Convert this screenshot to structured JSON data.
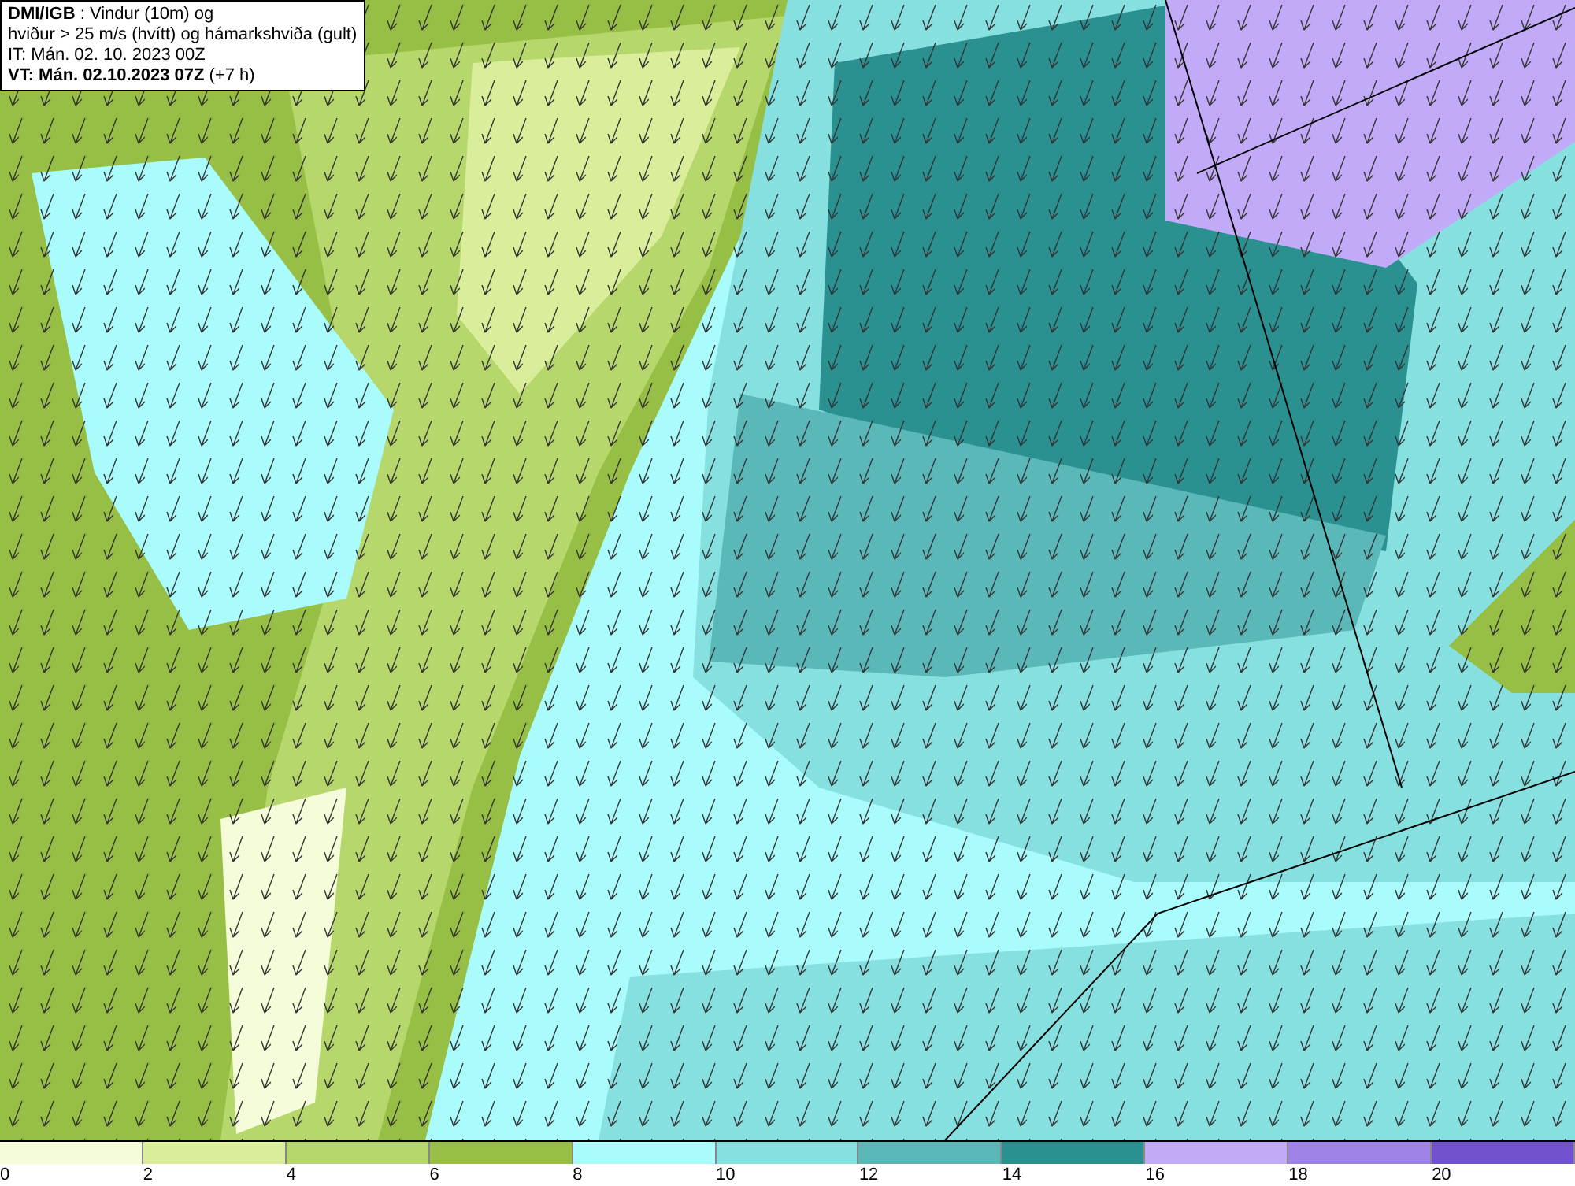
{
  "header": {
    "lines": [
      "**DMI/IGB** : Vindur (10m) og",
      "hviður > 25 m/s (hvítt) og hámarkshviða (gult)",
      "IT: Mán. 02. 10. 2023 00Z",
      "**VT: Mán. 02.10.2023 07Z** (+7 h)"
    ]
  },
  "legend": {
    "bins": [
      {
        "color": "#f5fcd9"
      },
      {
        "color": "#d9ed9a"
      },
      {
        "color": "#b5d76c"
      },
      {
        "color": "#98bf45"
      },
      {
        "color": "#aafbfb"
      },
      {
        "color": "#86e0e0"
      },
      {
        "color": "#5ab8b8"
      },
      {
        "color": "#2a9090"
      },
      {
        "color": "#c1aaf8"
      },
      {
        "color": "#9e82e6"
      },
      {
        "color": "#7252cc"
      }
    ],
    "labels": [
      "0",
      "2",
      "4",
      "6",
      "8",
      "10",
      "12",
      "14",
      "16",
      "18",
      "20"
    ]
  }
}
